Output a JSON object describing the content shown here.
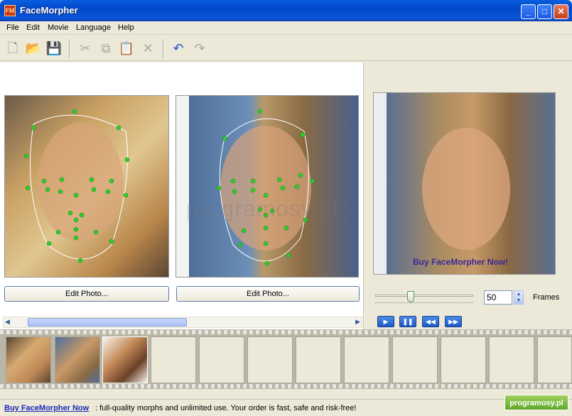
{
  "window": {
    "title": "FaceMorpher",
    "icon_text": "FM"
  },
  "titlebar_buttons": {
    "minimize": "_",
    "maximize": "□",
    "close": "✕"
  },
  "menu": [
    "File",
    "Edit",
    "Movie",
    "Language",
    "Help"
  ],
  "toolbar": {
    "icons": [
      "new-icon",
      "open-icon",
      "save-icon",
      "cut-icon",
      "copy-icon",
      "paste-icon",
      "delete-icon",
      "undo-icon",
      "redo-icon"
    ]
  },
  "editor": {
    "photo1_edit_label": "Edit Photo...",
    "photo2_edit_label": "Edit Photo..."
  },
  "preview": {
    "overlay_text": "Buy FaceMorpher Now!"
  },
  "frames": {
    "value": "50",
    "label": "Frames",
    "slider_position": 0.18
  },
  "playback": [
    "play-icon",
    "pause-icon",
    "rewind-icon",
    "forward-icon"
  ],
  "status": {
    "link": "Buy FaceMorpher Now",
    "message": ": full-quality morphs and unlimited use. Your order is fast, safe and risk-free!"
  },
  "watermark": "programosy.pl",
  "badge": "programosy.pl",
  "colors": {
    "accent": "#0a5fe0",
    "landmark": "#2bd02b",
    "link": "#1b2ab8"
  }
}
